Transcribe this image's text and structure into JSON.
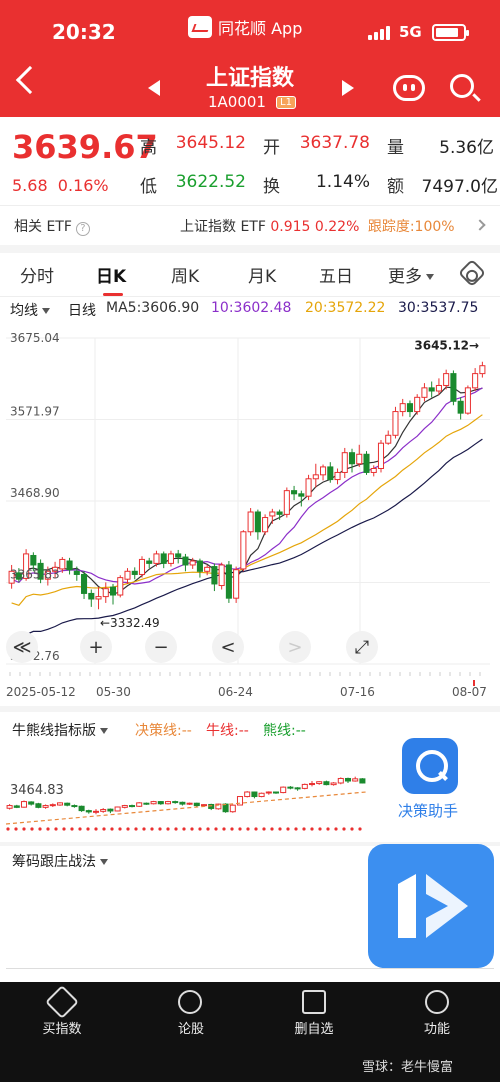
{
  "status": {
    "time": "20:32",
    "app": "同花顺 App",
    "network": "5G"
  },
  "header": {
    "title": "上证指数",
    "code": "1A0001",
    "level_tag": "L1"
  },
  "quote": {
    "price": "3639.67",
    "change": "5.68",
    "change_pct": "0.16%",
    "high_label": "高",
    "high": "3645.12",
    "low_label": "低",
    "low": "3622.52",
    "open_label": "开",
    "open": "3637.78",
    "turnover_label": "换",
    "turnover": "1.14%",
    "volume_label": "量",
    "volume": "5.36亿",
    "amount_label": "额",
    "amount": "7497.0亿"
  },
  "etf": {
    "label": "相关 ETF",
    "name": "上证指数 ETF",
    "price": "0.915",
    "pct": "0.22%",
    "track": "跟踪度:100%"
  },
  "tabs": [
    "分时",
    "日K",
    "周K",
    "月K",
    "五日",
    "更多"
  ],
  "ma": {
    "type": "均线",
    "period": "日线",
    "ma5": "MA5:3606.90",
    "ma10": "10:3602.48",
    "ma20": "20:3572.22",
    "ma30": "30:3537.75"
  },
  "chart_data": {
    "type": "candlestick",
    "y_ticks": [
      "3675.04",
      "3571.97",
      "3468.90",
      "3365.83",
      "3262.76"
    ],
    "ylim": [
      3262.76,
      3675.04
    ],
    "x_ticks": [
      "2025-05-12",
      "05-30",
      "06-24",
      "07-16",
      "08-07"
    ],
    "max_label": "3645.12→",
    "min_label": "←3332.49",
    "colors": {
      "up": "#e93030",
      "down": "#1a8a2e",
      "ma5": "#333333",
      "ma10": "#8b2fc9",
      "ma20": "#e5a50a",
      "ma30": "#1a1a4a"
    },
    "candles": [
      [
        3365,
        3380,
        3358,
        3388
      ],
      [
        3378,
        3370,
        3366,
        3384
      ],
      [
        3371,
        3402,
        3368,
        3408
      ],
      [
        3400,
        3388,
        3380,
        3404
      ],
      [
        3390,
        3370,
        3365,
        3395
      ],
      [
        3370,
        3380,
        3362,
        3386
      ],
      [
        3380,
        3385,
        3372,
        3392
      ],
      [
        3383,
        3395,
        3378,
        3398
      ],
      [
        3393,
        3382,
        3376,
        3397
      ],
      [
        3380,
        3376,
        3368,
        3386
      ],
      [
        3376,
        3352,
        3345,
        3380
      ],
      [
        3352,
        3345,
        3335,
        3357
      ],
      [
        3345,
        3348,
        3332,
        3360
      ],
      [
        3348,
        3358,
        3340,
        3366
      ],
      [
        3360,
        3350,
        3338,
        3364
      ],
      [
        3350,
        3372,
        3347,
        3375
      ],
      [
        3370,
        3380,
        3364,
        3384
      ],
      [
        3380,
        3376,
        3370,
        3385
      ],
      [
        3376,
        3395,
        3372,
        3399
      ],
      [
        3393,
        3390,
        3384,
        3397
      ],
      [
        3390,
        3402,
        3386,
        3406
      ],
      [
        3402,
        3390,
        3384,
        3405
      ],
      [
        3390,
        3402,
        3386,
        3406
      ],
      [
        3402,
        3398,
        3390,
        3407
      ],
      [
        3398,
        3388,
        3380,
        3402
      ],
      [
        3388,
        3393,
        3383,
        3397
      ],
      [
        3393,
        3380,
        3372,
        3396
      ],
      [
        3380,
        3385,
        3375,
        3388
      ],
      [
        3386,
        3364,
        3355,
        3390
      ],
      [
        3362,
        3388,
        3357,
        3391
      ],
      [
        3388,
        3346,
        3340,
        3393
      ],
      [
        3346,
        3382,
        3340,
        3386
      ],
      [
        3383,
        3430,
        3380,
        3432
      ],
      [
        3430,
        3455,
        3425,
        3460
      ],
      [
        3455,
        3430,
        3420,
        3458
      ],
      [
        3430,
        3448,
        3426,
        3452
      ],
      [
        3450,
        3455,
        3440,
        3459
      ],
      [
        3455,
        3452,
        3445,
        3458
      ],
      [
        3452,
        3482,
        3448,
        3486
      ],
      [
        3482,
        3478,
        3470,
        3488
      ],
      [
        3478,
        3475,
        3462,
        3482
      ],
      [
        3475,
        3497,
        3470,
        3502
      ],
      [
        3497,
        3502,
        3486,
        3516
      ],
      [
        3502,
        3512,
        3495,
        3515
      ],
      [
        3512,
        3496,
        3492,
        3518
      ],
      [
        3496,
        3505,
        3490,
        3510
      ],
      [
        3505,
        3530,
        3498,
        3536
      ],
      [
        3530,
        3516,
        3505,
        3535
      ],
      [
        3516,
        3528,
        3512,
        3540
      ],
      [
        3528,
        3505,
        3502,
        3532
      ],
      [
        3505,
        3510,
        3500,
        3514
      ],
      [
        3510,
        3542,
        3505,
        3546
      ],
      [
        3542,
        3552,
        3540,
        3558
      ],
      [
        3552,
        3582,
        3548,
        3588
      ],
      [
        3582,
        3592,
        3576,
        3598
      ],
      [
        3592,
        3582,
        3575,
        3596
      ],
      [
        3582,
        3600,
        3578,
        3604
      ],
      [
        3600,
        3612,
        3595,
        3618
      ],
      [
        3612,
        3608,
        3600,
        3620
      ],
      [
        3608,
        3615,
        3603,
        3624
      ],
      [
        3615,
        3630,
        3610,
        3635
      ],
      [
        3630,
        3595,
        3590,
        3634
      ],
      [
        3595,
        3580,
        3572,
        3600
      ],
      [
        3580,
        3612,
        3578,
        3615
      ],
      [
        3612,
        3630,
        3608,
        3637
      ],
      [
        3630,
        3640,
        3625,
        3645
      ]
    ]
  },
  "chart_controls": {
    "collapse": "≪",
    "zoom_in": "+",
    "zoom_out": "−",
    "prev": "<",
    "next": ">",
    "fullscreen": "⤢"
  },
  "panel1": {
    "title": "牛熊线指标版",
    "decision": "决策线:--",
    "bull": "牛线:--",
    "bear": "熊线:--",
    "value": "3464.83"
  },
  "assistant": {
    "label": "决策助手"
  },
  "panel2": {
    "title": "筹码跟庄战法"
  },
  "bottom_nav": [
    "买指数",
    "论股",
    "删自选",
    "功能"
  ],
  "watermark": "雪球：老牛慢富"
}
